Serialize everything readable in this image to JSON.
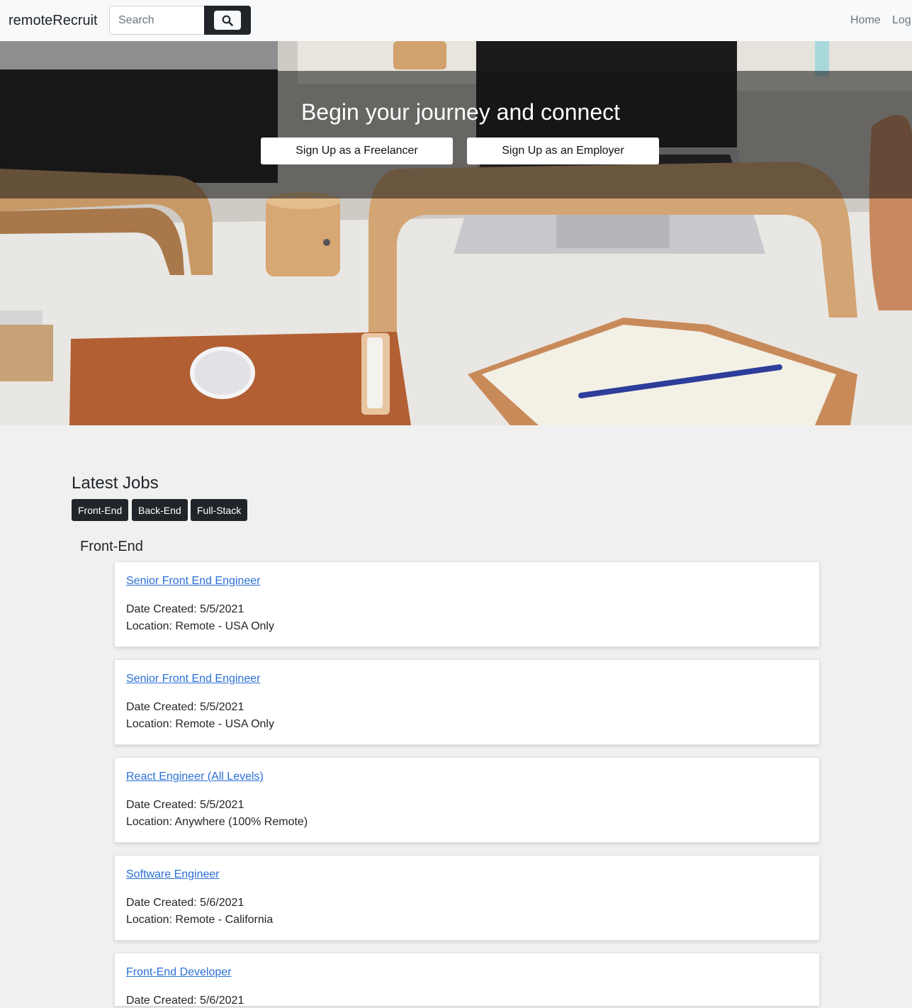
{
  "navbar": {
    "brand": "remoteRecruit",
    "search_placeholder": "Search",
    "search_icon": "search-icon",
    "links": [
      "Home",
      "Log"
    ]
  },
  "hero": {
    "title": "Begin your journey and connect",
    "freelancer_button": "Sign Up as a Freelancer",
    "employer_button": "Sign Up as an Employer"
  },
  "jobs_section": {
    "title": "Latest Jobs",
    "filters": [
      "Front-End",
      "Back-End",
      "Full-Stack"
    ],
    "category": "Front-End",
    "date_prefix": "Date Created:",
    "location_prefix": "Location:",
    "jobs": [
      {
        "title": "Senior Front End Engineer",
        "date": "Date Created: 5/5/2021",
        "location": "Location: Remote - USA Only"
      },
      {
        "title": "Senior Front End Engineer",
        "date": "Date Created: 5/5/2021",
        "location": "Location: Remote - USA Only"
      },
      {
        "title": "React Engineer (All Levels)",
        "date": "Date Created: 5/5/2021",
        "location": "Location: Anywhere (100% Remote)"
      },
      {
        "title": "Software Engineer",
        "date": "Date Created: 5/6/2021",
        "location": "Location: Remote - California"
      },
      {
        "title": "Front-End Developer",
        "date": "Date Created: 5/6/2021",
        "location": ""
      }
    ]
  },
  "colors": {
    "link": "#2a6fd6",
    "dark": "#212529",
    "navbar_bg": "#f8f9fa",
    "page_bg": "#f0f0f0"
  }
}
